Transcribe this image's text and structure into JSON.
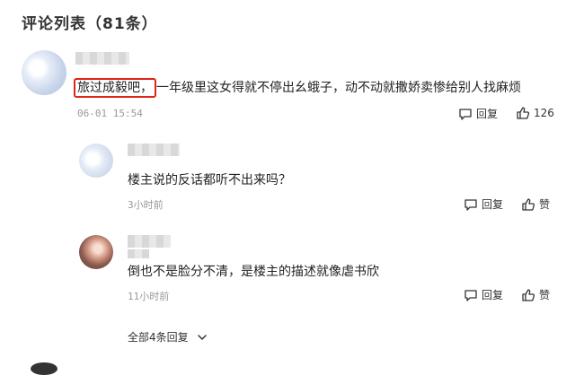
{
  "header": {
    "title": "评论列表（81条）"
  },
  "comments": [
    {
      "highlighted": "旅过成毅吧，",
      "text": "一年级里这女得就不停出幺蛾子，动不动就撒娇卖惨给别人找麻烦",
      "time": "06-01  15:54",
      "reply_label": "回复",
      "like_count": "126"
    },
    {
      "text": "楼主说的反话都听不出来吗？",
      "time": "3小时前",
      "reply_label": "回复",
      "like_label": "赞"
    },
    {
      "text": "倒也不是脸分不清，是楼主的描述就像虐书欣",
      "time": "11小时前",
      "reply_label": "回复",
      "like_label": "赞"
    }
  ],
  "more_replies": {
    "label": "全部4条回复"
  },
  "colors": {
    "highlight_border": "#e0241b",
    "meta": "#999999"
  },
  "icons": {
    "reply": "comment-bubble-icon",
    "like": "thumbs-up-icon",
    "expand": "chevron-down-icon"
  }
}
